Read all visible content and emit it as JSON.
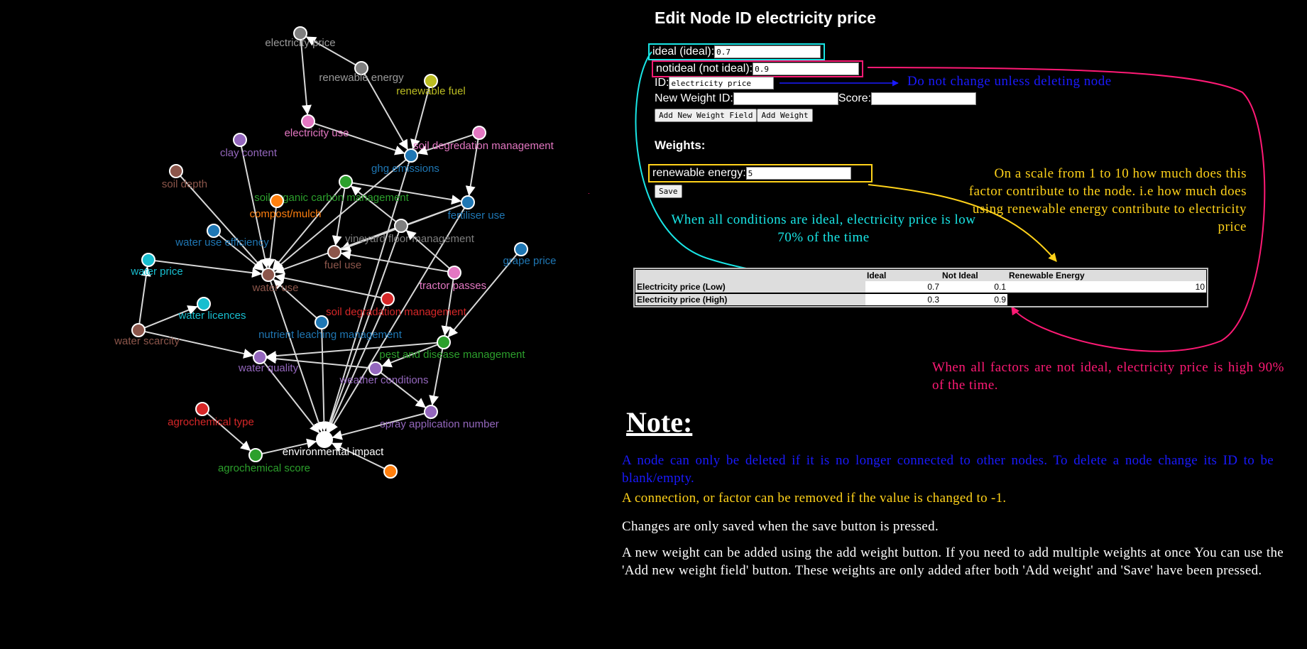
{
  "graph": {
    "nodes": [
      {
        "label": "electricity price",
        "color": "#7f7f7f",
        "label_color": "#9a9a9a"
      },
      {
        "label": "renewable energy",
        "color": "#7f7f7f",
        "label_color": "#9a9a9a"
      },
      {
        "label": "renewable fuel",
        "color": "#bcbd22",
        "label_color": "#bcbd22"
      },
      {
        "label": "electricity use",
        "color": "#e377c2",
        "label_color": "#e377c2"
      },
      {
        "label": "soil degredation management",
        "color": "#e377c2",
        "label_color": "#e377c2"
      },
      {
        "label": "clay content",
        "color": "#9467bd",
        "label_color": "#9467bd"
      },
      {
        "label": "ghg emissions",
        "color": "#1f77b4",
        "label_color": "#1f77b4"
      },
      {
        "label": "soil depth",
        "color": "#8c564b",
        "label_color": "#8c564b"
      },
      {
        "label": "soil organic carbon management",
        "color": "#2ca02c",
        "label_color": "#2ca02c"
      },
      {
        "label": "compost/mulch",
        "color": "#ff7f0e",
        "label_color": "#ff7f0e"
      },
      {
        "label": "fertiliser use",
        "color": "#1f77b4",
        "label_color": "#1f77b4"
      },
      {
        "label": "vineyard floor management",
        "color": "#7f7f7f",
        "label_color": "#7f7f7f"
      },
      {
        "label": "water use efficiency",
        "color": "#1f77b4",
        "label_color": "#1f77b4"
      },
      {
        "label": "grape price",
        "color": "#1f77b4",
        "label_color": "#1f77b4"
      },
      {
        "label": "water price",
        "color": "#17becf",
        "label_color": "#17becf"
      },
      {
        "label": "fuel use",
        "color": "#8c564b",
        "label_color": "#8c564b"
      },
      {
        "label": "water use",
        "color": "#8c564b",
        "label_color": "#8c564b"
      },
      {
        "label": "tractor passes",
        "color": "#e377c2",
        "label_color": "#e377c2"
      },
      {
        "label": "soil degradation management",
        "color": "#d62728",
        "label_color": "#d62728"
      },
      {
        "label": "water licences",
        "color": "#17becf",
        "label_color": "#17becf"
      },
      {
        "label": "nutrient leaching management",
        "color": "#1f77b4",
        "label_color": "#1f77b4"
      },
      {
        "label": "water scarcity",
        "color": "#8c564b",
        "label_color": "#8c564b"
      },
      {
        "label": "pest and disease management",
        "color": "#2ca02c",
        "label_color": "#2ca02c"
      },
      {
        "label": "water quality",
        "color": "#9467bd",
        "label_color": "#9467bd"
      },
      {
        "label": "weather conditions",
        "color": "#9467bd",
        "label_color": "#9467bd"
      },
      {
        "label": "agrochemical type",
        "color": "#d62728",
        "label_color": "#d62728"
      },
      {
        "label": "spray application number",
        "color": "#9467bd",
        "label_color": "#9467bd"
      },
      {
        "label": "environmental impact",
        "color": "#ffffff",
        "label_color": "#ffffff"
      },
      {
        "label": "agrochemical score",
        "color": "#2ca02c",
        "label_color": "#2ca02c"
      },
      {
        "label": "",
        "color": "#ff7f0e",
        "label_color": "#ff7f0e"
      }
    ],
    "edges": [
      [
        1,
        0
      ],
      [
        0,
        3
      ],
      [
        1,
        6
      ],
      [
        2,
        6
      ],
      [
        3,
        6
      ],
      [
        4,
        6
      ],
      [
        4,
        10
      ],
      [
        5,
        16
      ],
      [
        7,
        16
      ],
      [
        12,
        16
      ],
      [
        14,
        16
      ],
      [
        21,
        14
      ],
      [
        21,
        19
      ],
      [
        21,
        23
      ],
      [
        9,
        16
      ],
      [
        8,
        16
      ],
      [
        8,
        15
      ],
      [
        8,
        10
      ],
      [
        11,
        15
      ],
      [
        11,
        8
      ],
      [
        10,
        15
      ],
      [
        10,
        16
      ],
      [
        13,
        22
      ],
      [
        17,
        11
      ],
      [
        17,
        22
      ],
      [
        17,
        15
      ],
      [
        18,
        16
      ],
      [
        20,
        16
      ],
      [
        22,
        26
      ],
      [
        22,
        23
      ],
      [
        24,
        23
      ],
      [
        24,
        26
      ],
      [
        23,
        27
      ],
      [
        16,
        27
      ],
      [
        26,
        27
      ],
      [
        25,
        28
      ],
      [
        28,
        27
      ],
      [
        29,
        27
      ],
      [
        6,
        27
      ],
      [
        10,
        27
      ],
      [
        6,
        16
      ],
      [
        11,
        27
      ],
      [
        20,
        27
      ],
      [
        22,
        24
      ],
      [
        18,
        27
      ]
    ]
  },
  "panel": {
    "title": "Edit Node ID electricity price",
    "ideal_label": "ideal (ideal):",
    "ideal_value": "0.7",
    "notideal_label": "notideal (not ideal):",
    "notideal_value": "0.9",
    "id_label": "ID:",
    "id_value": "electricity price",
    "id_hint": "Do not change unless deleting node",
    "new_weight_label": "New Weight ID:",
    "new_weight_value": "",
    "score_label": "Score:",
    "score_value": "",
    "add_field_button": "Add New Weight Field",
    "add_weight_button": "Add Weight",
    "weights_heading": "Weights:",
    "weight_label": "renewable energy:",
    "weight_value": "5",
    "save_button": "Save"
  },
  "annotations": {
    "ideal_note": "When all conditions are ideal, electricity price is low 70% of the time",
    "scale_note": "On a scale from 1 to 10 how much does this factor contribute to the node. i.e how much does using renewable energy contribute to electricity price",
    "notideal_note": "When all factors are not ideal, electricity price is high 90% of the time."
  },
  "table": {
    "headers": [
      "",
      "Ideal",
      "Not Ideal",
      "Renewable Energy"
    ],
    "rows": [
      {
        "label": "Electricity price (Low)",
        "ideal": "0.7",
        "not_ideal": "0.1",
        "renewable": "10"
      },
      {
        "label": "Electricity price (High)",
        "ideal": "0.3",
        "not_ideal": "0.9",
        "renewable": ""
      }
    ]
  },
  "notes": {
    "heading": "Note:",
    "delete_note": "A node can only be deleted if it is no longer connected to other nodes. To delete a node change its ID to be blank/empty.",
    "remove_note": "A connection, or factor can be removed if the value is changed to -1.",
    "save_note": "Changes are only saved when the save button is pressed.",
    "add_note": "A new weight can be added using the add weight button. If you need to add multiple weights at once You can use the 'Add new weight field' button. These weights are only added after both 'Add weight' and 'Save' have been pressed."
  },
  "colors": {
    "cyan": "#19e6e6",
    "pink": "#ff1a75",
    "yellow": "#ffd21a",
    "blue": "#1a1aff"
  }
}
